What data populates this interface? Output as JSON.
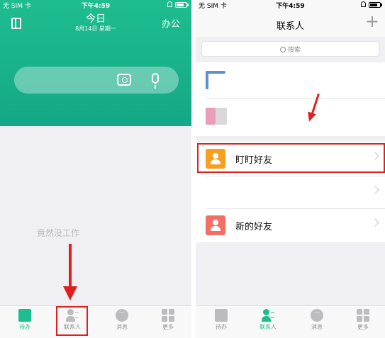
{
  "left_screen": {
    "status": {
      "carrier": "无 SIM 卡",
      "time": "下午4:59"
    },
    "header": {
      "title": "今日",
      "date": "8月14日 星期一",
      "office_label": "办公"
    },
    "search": {
      "placeholder": ""
    },
    "empty_text": "竟然没工作",
    "tabbar": [
      {
        "label": "待办",
        "icon": "todo-icon",
        "active": true
      },
      {
        "label": "联系人",
        "icon": "contacts-icon",
        "active": false
      },
      {
        "label": "消息",
        "icon": "message-icon",
        "active": false
      },
      {
        "label": "更多",
        "icon": "more-icon",
        "active": false
      }
    ]
  },
  "right_screen": {
    "status": {
      "carrier": "无 SIM 卡",
      "time": "下午4:59"
    },
    "header": {
      "title": "联系人",
      "add_label": "+"
    },
    "search": {
      "placeholder": "搜索"
    },
    "contacts": [
      {
        "label": "盯盯好友",
        "avatar_color": "#f5a020",
        "highlighted": true
      },
      {
        "label": "新的好友",
        "avatar_color": "#f36f66",
        "highlighted": false
      }
    ],
    "tabbar": [
      {
        "label": "待办",
        "icon": "todo-icon",
        "active": false
      },
      {
        "label": "联系人",
        "icon": "contacts-icon",
        "active": true
      },
      {
        "label": "消息",
        "icon": "message-icon",
        "active": false
      },
      {
        "label": "更多",
        "icon": "more-icon",
        "active": false
      }
    ]
  },
  "colors": {
    "accent": "#1ebd8f",
    "annotation": "#e0201c"
  }
}
